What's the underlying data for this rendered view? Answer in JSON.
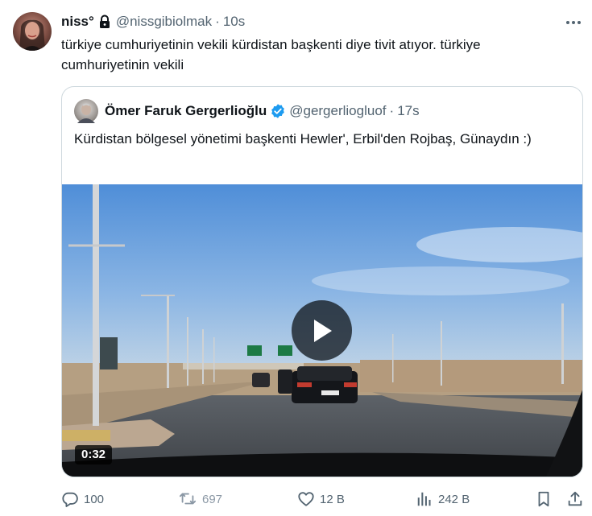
{
  "author": {
    "name": "niss°",
    "handle": "@nissgibiolmak",
    "time": "10s"
  },
  "separator": "·",
  "text": "türkiye cumhuriyetinin vekili kürdistan başkenti diye tivit atıyor. türkiye cumhuriyetinin vekili",
  "quote": {
    "name": "Ömer Faruk Gergerlioğlu",
    "handle": "@gergerliogluof",
    "time": "17s",
    "text": "Kürdistan bölgesel yönetimi başkenti Hewler', Erbil'den Rojbaş, Günaydın :)",
    "video": {
      "duration": "0:32"
    }
  },
  "actions": {
    "replies": "100",
    "retweets": "697",
    "likes": "12 B",
    "views": "242 B"
  },
  "icons": [
    "lock-icon",
    "more-icon",
    "verified-icon",
    "play-icon",
    "reply-icon",
    "retweet-icon",
    "like-icon",
    "views-icon",
    "bookmark-icon",
    "share-icon"
  ],
  "colors": {
    "verified": "#1d9bf0",
    "secondary_text": "#536471",
    "border": "#cfd9de"
  }
}
